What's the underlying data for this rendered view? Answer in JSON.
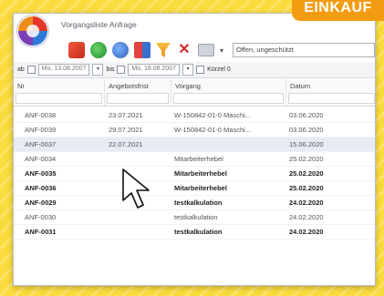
{
  "badge": "EINKAUF",
  "window": {
    "title": "Vorgangsliste Anfrage"
  },
  "toolbar": {
    "icons": [
      "new-doc-icon",
      "refresh-icon",
      "globe-icon",
      "book-icon",
      "filter-icon",
      "delete-icon",
      "print-icon"
    ],
    "filter_value": "Offen, ungeschützt"
  },
  "datebar": {
    "from_label": "ab",
    "from_date": "Mo, 13.08.2007",
    "to_label": "bis",
    "to_date": "Mo, 18.08.2007",
    "extra_label": "Kürzel 0"
  },
  "columns": [
    "Nr",
    "Angebotsfrist",
    "Vorgang",
    "Datum"
  ],
  "rows": [
    {
      "nr": "ANF-0038",
      "frist": "23.07.2021",
      "vorgang": "W-150842-01-0 Maschi...",
      "datum": "03.06.2020",
      "bold": false,
      "selected": false
    },
    {
      "nr": "ANF-0039",
      "frist": "29.07.2021",
      "vorgang": "W-150842-01-0 Maschi...",
      "datum": "03.06.2020",
      "bold": false,
      "selected": false
    },
    {
      "nr": "ANF-0037",
      "frist": "22.07.2021",
      "vorgang": "",
      "datum": "15.06.2020",
      "bold": false,
      "selected": true
    },
    {
      "nr": "ANF-0034",
      "frist": "",
      "vorgang": "Mitarbeiterhebel",
      "datum": "25.02.2020",
      "bold": false,
      "selected": false
    },
    {
      "nr": "ANF-0035",
      "frist": "",
      "vorgang": "Mitarbeiterhebel",
      "datum": "25.02.2020",
      "bold": true,
      "selected": false
    },
    {
      "nr": "ANF-0036",
      "frist": "",
      "vorgang": "Mitarbeiterhebel",
      "datum": "25.02.2020",
      "bold": true,
      "selected": false
    },
    {
      "nr": "ANF-0029",
      "frist": "",
      "vorgang": "testkalkulation",
      "datum": "24.02.2020",
      "bold": true,
      "selected": false
    },
    {
      "nr": "ANF-0030",
      "frist": "",
      "vorgang": "testkalkulation",
      "datum": "24.02.2020",
      "bold": false,
      "selected": false
    },
    {
      "nr": "ANF-0031",
      "frist": "",
      "vorgang": "testkalkulation",
      "datum": "24.02.2020",
      "bold": true,
      "selected": false
    }
  ]
}
